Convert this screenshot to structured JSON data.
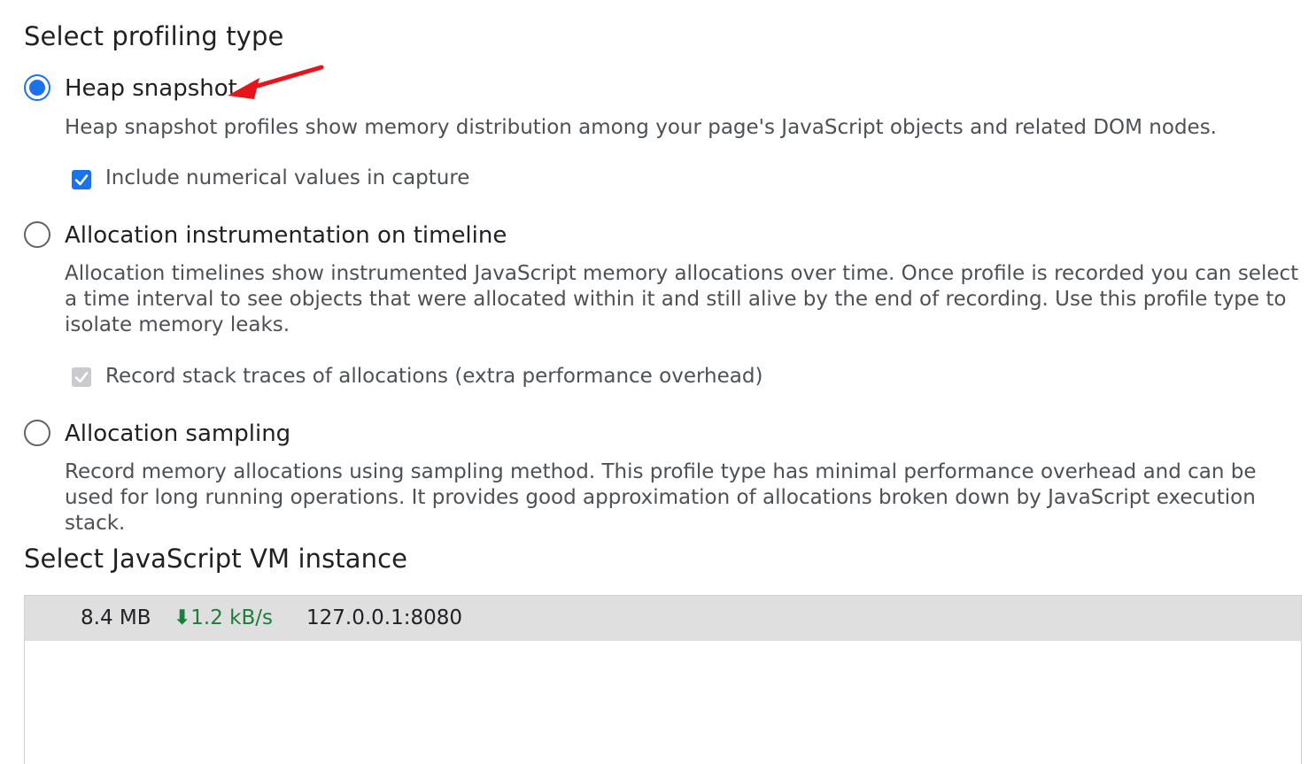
{
  "profiling": {
    "title": "Select profiling type",
    "options": [
      {
        "label": "Heap snapshot",
        "selected": true,
        "description": "Heap snapshot profiles show memory distribution among your page's JavaScript objects and related DOM nodes.",
        "checkbox": {
          "label": "Include numerical values in capture",
          "checked": true,
          "disabled": false
        }
      },
      {
        "label": "Allocation instrumentation on timeline",
        "selected": false,
        "description": "Allocation timelines show instrumented JavaScript memory allocations over time. Once profile is recorded you can select a time interval to see objects that were allocated within it and still alive by the end of recording. Use this profile type to isolate memory leaks.",
        "checkbox": {
          "label": "Record stack traces of allocations (extra performance overhead)",
          "checked": true,
          "disabled": true
        }
      },
      {
        "label": "Allocation sampling",
        "selected": false,
        "description": "Record memory allocations using sampling method. This profile type has minimal performance overhead and can be used for long running operations. It provides good approximation of allocations broken down by JavaScript execution stack."
      }
    ]
  },
  "vm": {
    "title": "Select JavaScript VM instance",
    "instances": [
      {
        "size": "8.4 MB",
        "rate_arrow": "⬇",
        "rate": "1.2 kB/s",
        "url": "127.0.0.1:8080"
      }
    ]
  },
  "colors": {
    "accent": "#1a73e8",
    "annotation_arrow": "#e8141c",
    "rate_green": "#188038"
  },
  "icons": {
    "annotation": "red-arrow-icon",
    "download": "down-arrow-icon",
    "checkmark": "checkmark-icon"
  }
}
